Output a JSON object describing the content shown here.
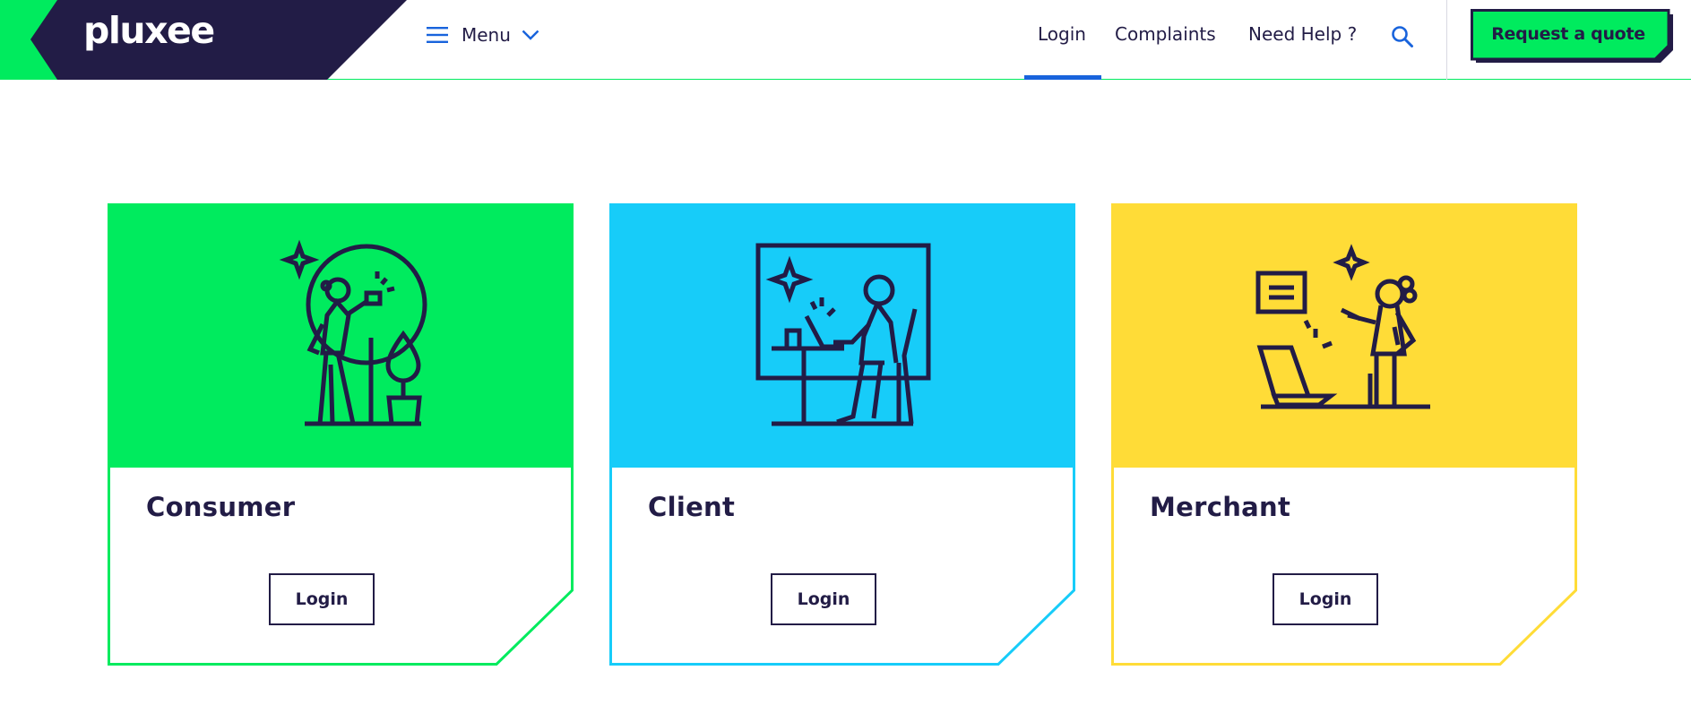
{
  "header": {
    "logo_text": "pluxee",
    "menu_label": "Menu",
    "nav": [
      {
        "label": "Login",
        "active": true
      },
      {
        "label": "Complaints",
        "active": false
      },
      {
        "label": "Need Help ?",
        "active": false
      }
    ],
    "search_icon": "search-icon",
    "quote_button": "Request a quote"
  },
  "colors": {
    "navy": "#221c46",
    "green": "#00eb5e",
    "blue": "#17ccf9",
    "yellow": "#ffdc37",
    "link_blue": "#1863dc"
  },
  "cards": [
    {
      "title": "Consumer",
      "button": "Login",
      "color": "#00eb5e",
      "illustration": "woman-with-card-icon"
    },
    {
      "title": "Client",
      "button": "Login",
      "color": "#17ccf9",
      "illustration": "person-at-laptop-icon"
    },
    {
      "title": "Merchant",
      "button": "Login",
      "color": "#ffdc37",
      "illustration": "merchant-with-laptop-icon"
    }
  ]
}
